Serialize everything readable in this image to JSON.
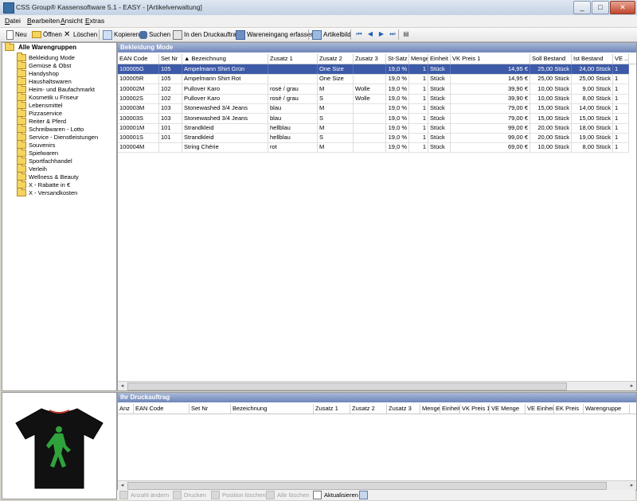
{
  "window": {
    "title": "CSS Group® Kassensoftware 5.1 - EASY - [Artikelverwaltung]",
    "buttons": [
      "_",
      "□",
      "✕"
    ]
  },
  "menu": [
    "Datei",
    "Bearbeiten",
    "Ansicht",
    "Extras"
  ],
  "toolbar": {
    "neu": "Neu",
    "oeffnen": "Öffnen",
    "loeschen": "Löschen",
    "kopieren": "Kopieren",
    "suchen": "Suchen",
    "druckauftrag": "In den Druckauftrag",
    "wareneingang": "Wareneingang erfassen",
    "artikelbild": "Artikelbild"
  },
  "tree": {
    "root": "Alle Warengruppen",
    "items": [
      "Bekleidung Mode",
      "Gemüse & Obst",
      "Handyshop",
      "Haushaltswaren",
      "Heim- und Baufachmarkt",
      "Kosmetik u Friseur",
      "Lebensmittel",
      "Pizzaservice",
      "Reiter & Pferd",
      "Schreibwaren - Lotto",
      "Service - Dienstleistungen",
      "Souvenirs",
      "Spielwaren",
      "Sportfachhandel",
      "Verleih",
      "Wellness & Beauty",
      "X - Rabatte in €",
      "X - Versandkosten"
    ]
  },
  "articles": {
    "title": "Bekleidung Mode",
    "columns": [
      "EAN Code",
      "Set Nr",
      "▲ Bezeichnung",
      "Zusatz 1",
      "Zusatz 2",
      "Zusatz 3",
      "St-Satz",
      "Menge",
      "Einheit",
      "VK Preis 1",
      "Soll Bestand",
      "Ist Bestand",
      "VE ..."
    ],
    "rows": [
      [
        "100005G",
        "105",
        "Ampelmann Shirt Grün",
        "",
        "One Size",
        "",
        "19,0 %",
        "1",
        "Stück",
        "14,95 €",
        "25,00 Stück",
        "24,00 Stück",
        "1"
      ],
      [
        "100005R",
        "105",
        "Ampelmann Shirt Rot",
        "",
        "One Size",
        "",
        "19,0 %",
        "1",
        "Stück",
        "14,95 €",
        "25,00 Stück",
        "25,00 Stück",
        "1"
      ],
      [
        "100002M",
        "102",
        "Pullover Karo",
        "rosé / grau",
        "M",
        "Wolle",
        "19,0 %",
        "1",
        "Stück",
        "39,90 €",
        "10,00 Stück",
        "9,00 Stück",
        "1"
      ],
      [
        "100002S",
        "102",
        "Pullover Karo",
        "rosé / grau",
        "S",
        "Wolle",
        "19,0 %",
        "1",
        "Stück",
        "39,90 €",
        "10,00 Stück",
        "8,00 Stück",
        "1"
      ],
      [
        "100003M",
        "103",
        "Stonewashed 3/4 Jeans",
        "blau",
        "M",
        "",
        "19,0 %",
        "1",
        "Stück",
        "79,00 €",
        "15,00 Stück",
        "14,00 Stück",
        "1"
      ],
      [
        "100003S",
        "103",
        "Stonewashed 3/4 Jeans",
        "blau",
        "S",
        "",
        "19,0 %",
        "1",
        "Stück",
        "79,00 €",
        "15,00 Stück",
        "15,00 Stück",
        "1"
      ],
      [
        "100001M",
        "101",
        "Strandkleid",
        "hellblau",
        "M",
        "",
        "19,0 %",
        "1",
        "Stück",
        "99,00 €",
        "20,00 Stück",
        "18,00 Stück",
        "1"
      ],
      [
        "100001S",
        "101",
        "Strandkleid",
        "hellblau",
        "S",
        "",
        "19,0 %",
        "1",
        "Stück",
        "99,00 €",
        "20,00 Stück",
        "19,00 Stück",
        "1"
      ],
      [
        "100004M",
        "",
        "String Chérie",
        "rot",
        "M",
        "",
        "19,0 %",
        "1",
        "Stück",
        "69,00 €",
        "10,00 Stück",
        "8,00 Stück",
        "1"
      ]
    ]
  },
  "druckauftrag": {
    "title": "Ihr Druckauftrag",
    "columns": [
      "Anz",
      "EAN Code",
      "Set Nr",
      "Bezeichnung",
      "Zusatz 1",
      "Zusatz 2",
      "Zusatz 3",
      "Menge",
      "Einheit",
      "VK Preis 1",
      "VE Menge",
      "VE Einheit",
      "EK Preis",
      "Warengruppe"
    ]
  },
  "bottombar": {
    "anzahl": "Anzahl ändern",
    "drucken": "Drucken",
    "position": "Position löschen",
    "alle": "Alle löschen",
    "aktualisieren": "Aktualisieren"
  },
  "colors": {
    "selection": "#3d5aa8",
    "panel_title": "#6f86b8",
    "shirt_figure": "#2fa23c",
    "shirt_collar": "#c0392b"
  },
  "icons": {
    "tree_item": "folder-icon",
    "neu": "new-doc-icon",
    "oeffnen": "open-folder-icon",
    "loeschen": "delete-x-icon",
    "kopieren": "copy-icon",
    "suchen": "binoculars-icon",
    "druckauftrag": "print-job-icon",
    "wareneingang": "goods-receipt-icon",
    "artikelbild": "image-icon"
  }
}
